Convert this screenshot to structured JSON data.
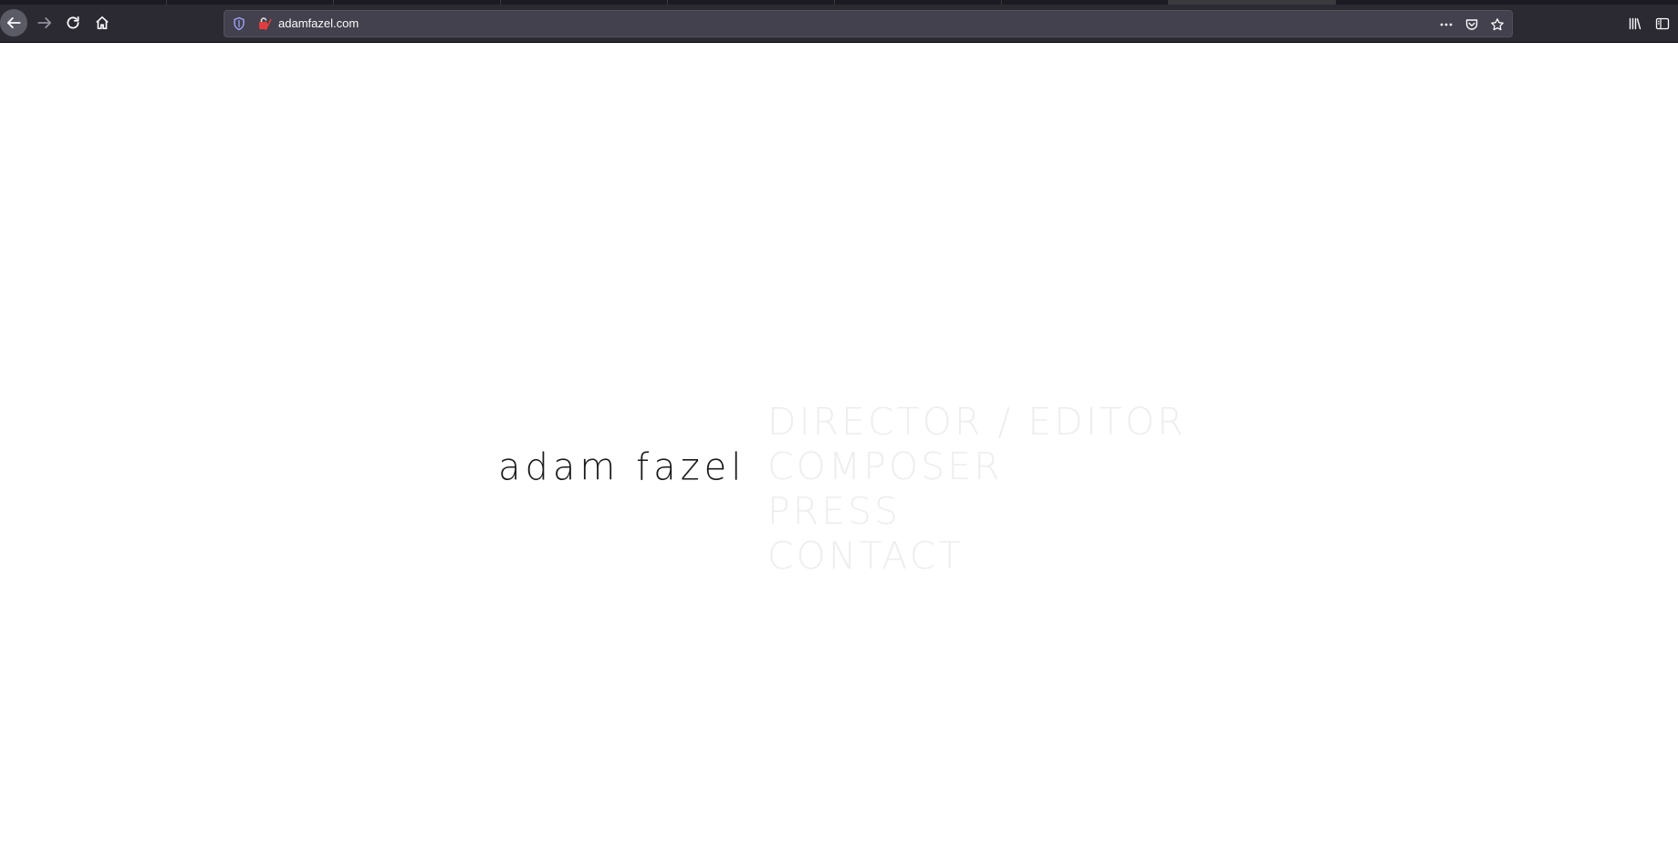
{
  "browser": {
    "url": "adamfazel.com",
    "icons": {
      "back": "arrow-left-icon",
      "forward": "arrow-right-icon",
      "reload": "reload-icon",
      "home": "home-icon",
      "tracking": "shield-icon",
      "site": "site-favicon-icon",
      "more": "more-horizontal-icon",
      "pocket": "pocket-icon",
      "bookmark": "star-icon",
      "library": "library-icon",
      "sidebar": "sidebar-icon"
    },
    "colors": {
      "toolbar": "#2b2a33",
      "urlbar": "#42414d"
    }
  },
  "site": {
    "name": "adam fazel",
    "menu": [
      {
        "label": "DIRECTOR / EDITOR"
      },
      {
        "label": "COMPOSER"
      },
      {
        "label": "PRESS"
      },
      {
        "label": "CONTACT"
      }
    ],
    "colors": {
      "name": "#1a1a1a",
      "menu": "#eeeeee",
      "background": "#ffffff"
    }
  }
}
